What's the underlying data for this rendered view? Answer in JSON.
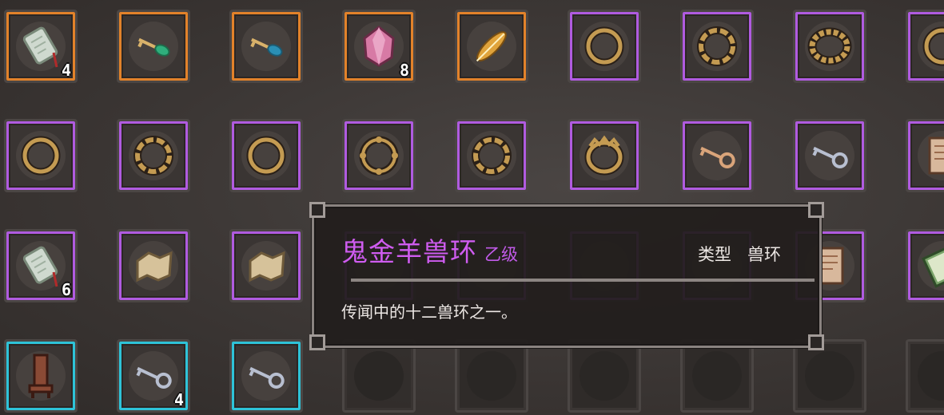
{
  "inventory": {
    "rows": [
      [
        {
          "rarity": "orange",
          "item": "tablet-icon",
          "count": "4"
        },
        {
          "rarity": "orange",
          "item": "green-key-icon",
          "count": ""
        },
        {
          "rarity": "orange",
          "item": "blue-key-icon",
          "count": ""
        },
        {
          "rarity": "orange",
          "item": "pink-crystal-icon",
          "count": "8"
        },
        {
          "rarity": "orange",
          "item": "golden-feather-icon",
          "count": ""
        },
        {
          "rarity": "purple",
          "item": "plain-ring-icon",
          "count": ""
        },
        {
          "rarity": "purple",
          "item": "twisted-ring-icon",
          "count": ""
        },
        {
          "rarity": "purple",
          "item": "braided-ring-icon",
          "count": ""
        },
        {
          "rarity": "purple",
          "item": "plain-ring-icon",
          "count": ""
        }
      ],
      [
        {
          "rarity": "purple",
          "item": "plain-ring-icon",
          "count": ""
        },
        {
          "rarity": "purple",
          "item": "twisted-ring-icon",
          "count": ""
        },
        {
          "rarity": "purple",
          "item": "plain-ring-icon",
          "count": ""
        },
        {
          "rarity": "purple",
          "item": "studded-ring-icon",
          "count": ""
        },
        {
          "rarity": "purple",
          "item": "twisted-ring-icon",
          "count": ""
        },
        {
          "rarity": "purple",
          "item": "crown-ring-icon",
          "count": ""
        },
        {
          "rarity": "purple",
          "item": "bronze-key-icon",
          "count": ""
        },
        {
          "rarity": "purple",
          "item": "silver-key-icon",
          "count": ""
        },
        {
          "rarity": "purple",
          "item": "scroll-icon",
          "count": ""
        }
      ],
      [
        {
          "rarity": "purple",
          "item": "tablet-icon",
          "count": "6"
        },
        {
          "rarity": "purple",
          "item": "map-icon",
          "count": ""
        },
        {
          "rarity": "purple",
          "item": "map-icon",
          "count": ""
        },
        {
          "rarity": "purple",
          "item": "hidden",
          "count": ""
        },
        {
          "rarity": "purple",
          "item": "hidden",
          "count": ""
        },
        {
          "rarity": "purple",
          "item": "hidden",
          "count": ""
        },
        {
          "rarity": "purple",
          "item": "hidden",
          "count": ""
        },
        {
          "rarity": "purple",
          "item": "scroll-icon",
          "count": ""
        },
        {
          "rarity": "purple",
          "item": "book-icon",
          "count": ""
        }
      ],
      [
        {
          "rarity": "cyan",
          "item": "chair-icon",
          "count": ""
        },
        {
          "rarity": "cyan",
          "item": "silver-key-icon",
          "count": "4"
        },
        {
          "rarity": "cyan",
          "item": "silver-key-icon",
          "count": ""
        },
        {
          "rarity": "empty",
          "item": "",
          "count": ""
        },
        {
          "rarity": "empty",
          "item": "",
          "count": ""
        },
        {
          "rarity": "empty",
          "item": "",
          "count": ""
        },
        {
          "rarity": "empty",
          "item": "",
          "count": ""
        },
        {
          "rarity": "empty",
          "item": "",
          "count": ""
        },
        {
          "rarity": "empty",
          "item": "",
          "count": ""
        }
      ]
    ]
  },
  "tooltip": {
    "name": "鬼金羊兽环",
    "grade": "乙级",
    "type_label": "类型",
    "type_value": "兽环",
    "description": "传闻中的十二兽环之一。"
  },
  "colors": {
    "orange": "#e2822a",
    "purple": "#b05be0",
    "cyan": "#2ec3d8",
    "name_color": "#cf5cf0"
  }
}
